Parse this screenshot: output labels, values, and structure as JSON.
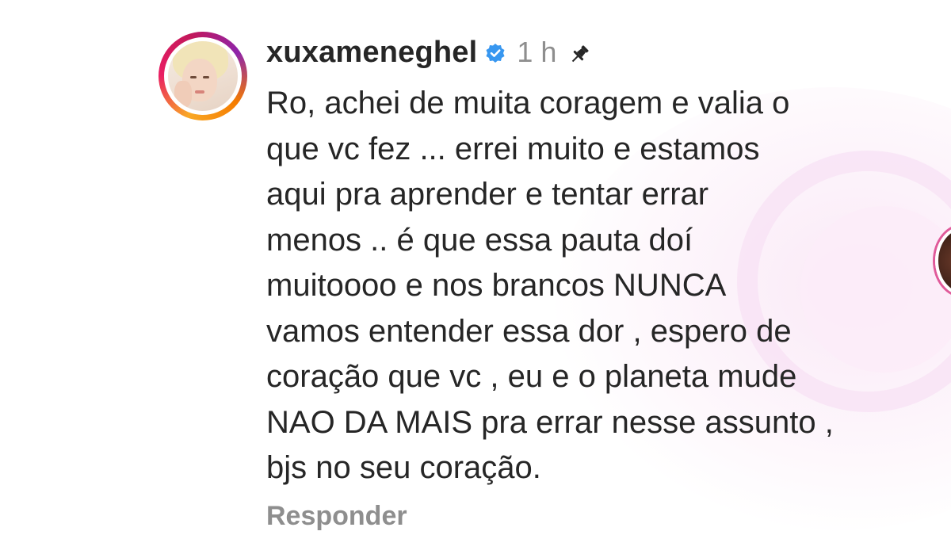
{
  "comment": {
    "username": "xuxameneghel",
    "verified_icon": "verified-badge-icon",
    "timestamp": "1 h",
    "pinned_icon": "pin-icon",
    "lines": [
      "Ro, achei de muita coragem e valia o",
      "que vc fez ... errei muito e estamos",
      "aqui pra aprender e tentar errar",
      "menos .. é que essa pauta doí",
      "muitoooo e nos brancos NUNCA",
      "vamos entender essa dor , espero de",
      "coração que vc , eu e o planeta mude",
      "NAO DA MAIS pra errar nesse assunto ,",
      "bjs no seu coração."
    ],
    "reply_label": "Responder"
  },
  "colors": {
    "text": "#262626",
    "secondary_text": "#8e8e8e",
    "verified_blue": "#3897f0",
    "background": "#ffffff"
  }
}
